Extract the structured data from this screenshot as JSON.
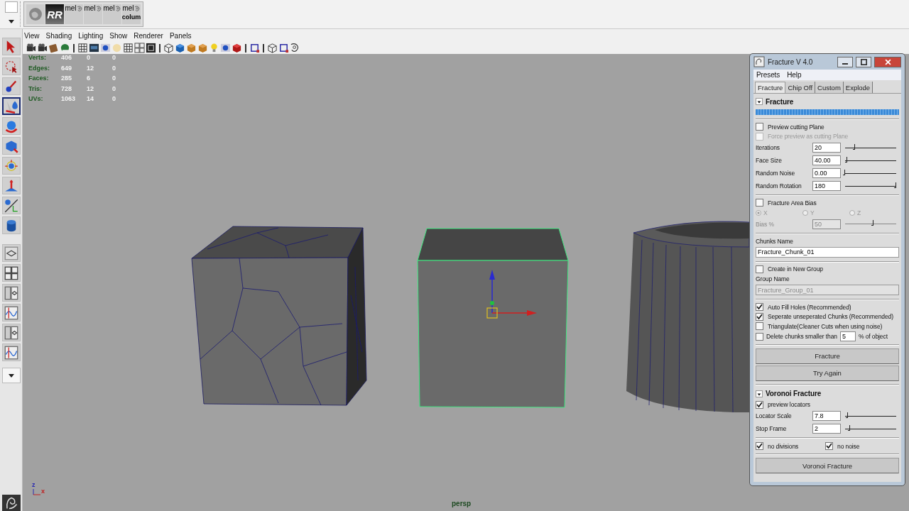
{
  "shelf": {
    "items": [
      {
        "kind": "image"
      },
      {
        "kind": "logo",
        "label": "RR"
      },
      {
        "kind": "mel",
        "label": "mel"
      },
      {
        "kind": "mel",
        "label": "mel"
      },
      {
        "kind": "mel",
        "label": "mel"
      },
      {
        "kind": "mel",
        "label": "mel",
        "caption": "colum"
      }
    ]
  },
  "viewport": {
    "menu": [
      "View",
      "Shading",
      "Lighting",
      "Show",
      "Renderer",
      "Panels"
    ],
    "hud": [
      {
        "label": "Verts:",
        "values": [
          "406",
          "0",
          "0"
        ]
      },
      {
        "label": "Edges:",
        "values": [
          "649",
          "12",
          "0"
        ]
      },
      {
        "label": "Faces:",
        "values": [
          "285",
          "6",
          "0"
        ]
      },
      {
        "label": "Tris:",
        "values": [
          "728",
          "12",
          "0"
        ]
      },
      {
        "label": "UVs:",
        "values": [
          "1063",
          "14",
          "0"
        ]
      }
    ],
    "axis": [
      "z",
      "x"
    ],
    "camera": "persp"
  },
  "fracture": {
    "title": "Fracture V 4.0",
    "menu": [
      "Presets",
      "Help"
    ],
    "tabs": [
      {
        "label": "Fracture",
        "selected": true
      },
      {
        "label": "Chip Off",
        "selected": false
      },
      {
        "label": "Custom",
        "selected": false
      },
      {
        "label": "Explode",
        "selected": false
      }
    ],
    "sections": [
      {
        "title": "Fracture",
        "expanded": true,
        "controls": [
          {
            "kind": "progress",
            "level": 1
          },
          {
            "kind": "separator"
          },
          {
            "kind": "checkbox",
            "label": "Preview cutting Plane",
            "checked": false,
            "disabled": false
          },
          {
            "kind": "checkbox",
            "label": "Force preview as cutting Plane",
            "checked": false,
            "disabled": true
          },
          {
            "kind": "slider",
            "label": "Iterations",
            "value": "20",
            "level": 0.2,
            "disabled": false
          },
          {
            "kind": "slider",
            "label": "Face Size",
            "value": "40.00",
            "level": 0.04,
            "disabled": false
          },
          {
            "kind": "slider",
            "label": "Random Noise",
            "value": "0.00",
            "level": 0,
            "disabled": false
          },
          {
            "kind": "slider",
            "label": "Random Rotation",
            "value": "180",
            "level": 1,
            "disabled": false
          },
          {
            "kind": "separator"
          },
          {
            "kind": "checkbox",
            "label": "Fracture Area Bias",
            "checked": false,
            "disabled": false
          },
          {
            "kind": "radios",
            "disabled": true,
            "options": [
              {
                "label": "X",
                "selected": true
              },
              {
                "label": "Y",
                "selected": false
              },
              {
                "label": "Z",
                "selected": false
              }
            ]
          },
          {
            "kind": "slider",
            "label": "Bias %",
            "value": "50",
            "level": 0.55,
            "disabled": true
          },
          {
            "kind": "separator"
          },
          {
            "kind": "label",
            "label": "Chunks Name"
          },
          {
            "kind": "text_field",
            "value": "Fracture_Chunk_01",
            "disabled": false
          },
          {
            "kind": "separator"
          },
          {
            "kind": "checkbox",
            "label": "Create in New Group",
            "checked": false,
            "disabled": false
          },
          {
            "kind": "label",
            "label": "Group Name"
          },
          {
            "kind": "text_field",
            "value": "Fracture_Group_01",
            "disabled": true
          },
          {
            "kind": "separator"
          },
          {
            "kind": "checkbox",
            "label": "Auto Fill Holes (Recommended)",
            "checked": true,
            "disabled": false
          },
          {
            "kind": "checkbox",
            "label": "Seperate unseperated Chunks (Recommended)",
            "checked": true,
            "disabled": false
          },
          {
            "kind": "checkbox",
            "label": "Triangulate(Cleaner Cuts when using noise)",
            "checked": false,
            "disabled": false
          },
          {
            "kind": "checkbox_field",
            "label": "Delete chunks smaller than",
            "checked": false,
            "value": "5",
            "suffix": "% of object"
          },
          {
            "kind": "separator"
          },
          {
            "kind": "button",
            "label": "Fracture"
          },
          {
            "kind": "button",
            "label": "Try Again"
          }
        ]
      },
      {
        "title": "Voronoi Fracture",
        "expanded": true,
        "controls": [
          {
            "kind": "checkbox",
            "label": "preview locators",
            "checked": true,
            "disabled": false
          },
          {
            "kind": "slider",
            "label": "Locator Scale",
            "value": "7.8",
            "level": 0.05,
            "disabled": false
          },
          {
            "kind": "slider",
            "label": "Stop Frame",
            "value": "2",
            "level": 0.1,
            "disabled": false
          },
          {
            "kind": "separator"
          },
          {
            "kind": "checkbox_pair",
            "items": [
              {
                "label": "no divisions",
                "checked": true
              },
              {
                "label": "no noise",
                "checked": true
              }
            ]
          },
          {
            "kind": "separator"
          },
          {
            "kind": "button",
            "label": "Voronoi Fracture"
          }
        ]
      }
    ]
  }
}
